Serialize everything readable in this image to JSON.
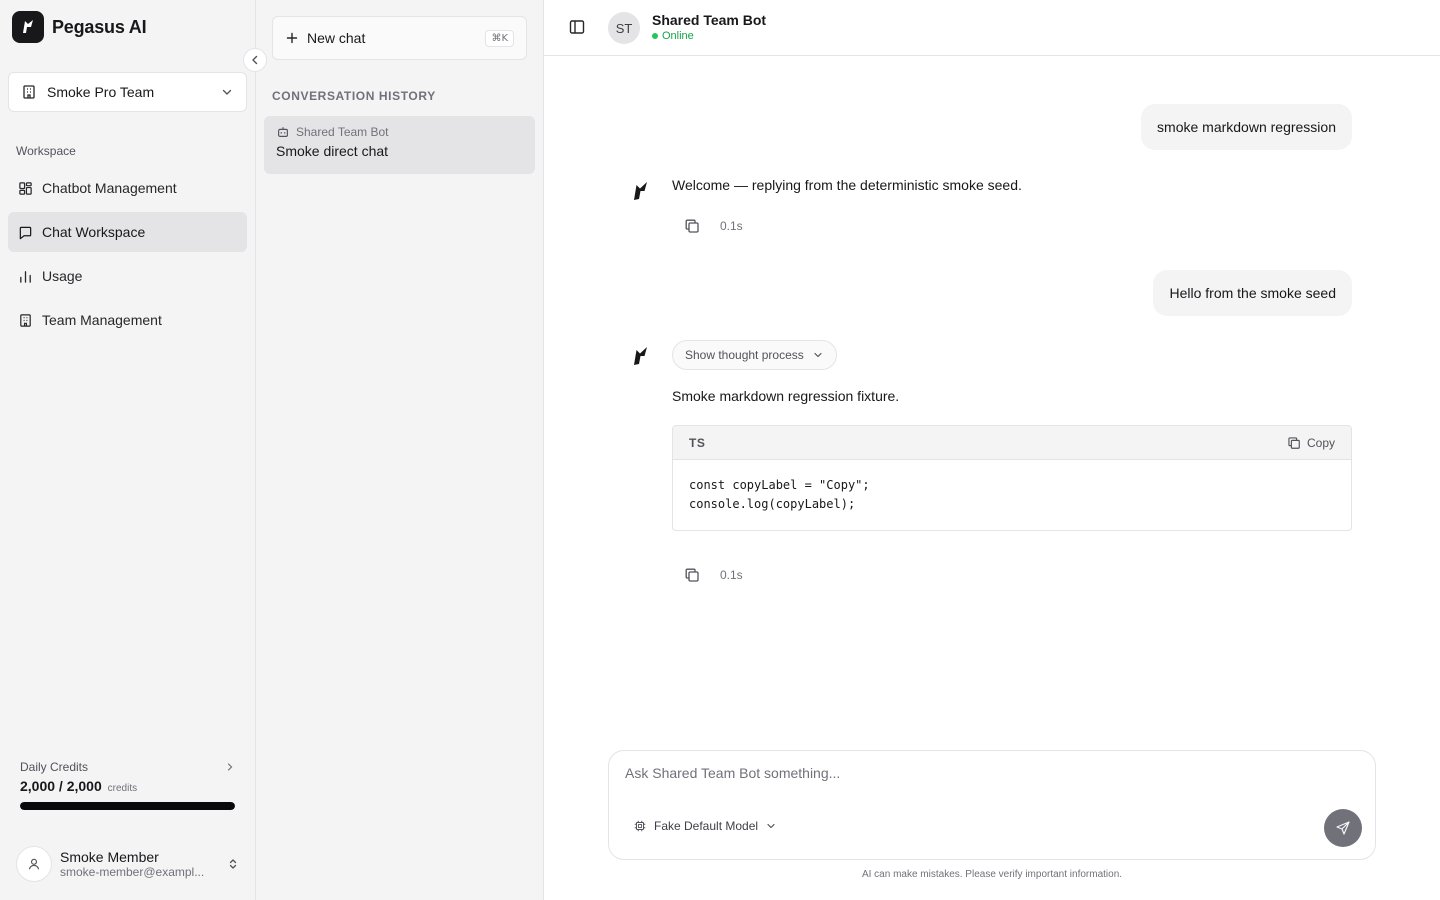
{
  "brand": {
    "name": "Pegasus AI"
  },
  "team": {
    "selected": "Smoke Pro Team"
  },
  "sidebar": {
    "section_label": "Workspace",
    "items": [
      {
        "label": "Chatbot Management",
        "icon": "dashboard-icon"
      },
      {
        "label": "Chat Workspace",
        "icon": "message-square-icon",
        "active": true
      },
      {
        "label": "Usage",
        "icon": "bar-chart-icon"
      },
      {
        "label": "Team Management",
        "icon": "building-icon"
      }
    ]
  },
  "credits": {
    "label": "Daily Credits",
    "value": "2,000 / 2,000",
    "unit": "credits",
    "fraction_remaining": 1.0
  },
  "user": {
    "name": "Smoke Member",
    "email": "smoke-member@exampl..."
  },
  "history": {
    "new_chat_label": "New chat",
    "shortcut": "⌘K",
    "title": "CONVERSATION HISTORY",
    "items": [
      {
        "bot": "Shared Team Bot",
        "title": "Smoke direct chat"
      }
    ]
  },
  "chat": {
    "avatar_initials": "ST",
    "bot_name": "Shared Team Bot",
    "status": "Online",
    "messages": {
      "user_1": "smoke markdown regression",
      "bot_1": "Welcome — replying from the deterministic smoke seed.",
      "bot_1_time": "0.1s",
      "user_2": "Hello from the smoke seed",
      "thought_label": "Show thought process",
      "bot_2": "Smoke markdown regression fixture.",
      "bot_2_time": "0.1s"
    },
    "code": {
      "language": "TS",
      "copy_label": "Copy",
      "lines": [
        "const copyLabel = \"Copy\";",
        "console.log(copyLabel);"
      ]
    }
  },
  "composer": {
    "placeholder": "Ask Shared Team Bot something...",
    "model": "Fake Default Model",
    "disclaimer": "AI can make mistakes. Please verify important information."
  },
  "colors": {
    "accent": "#18181b",
    "online": "#22c55e",
    "sidebar_bg": "#f4f4f5"
  }
}
